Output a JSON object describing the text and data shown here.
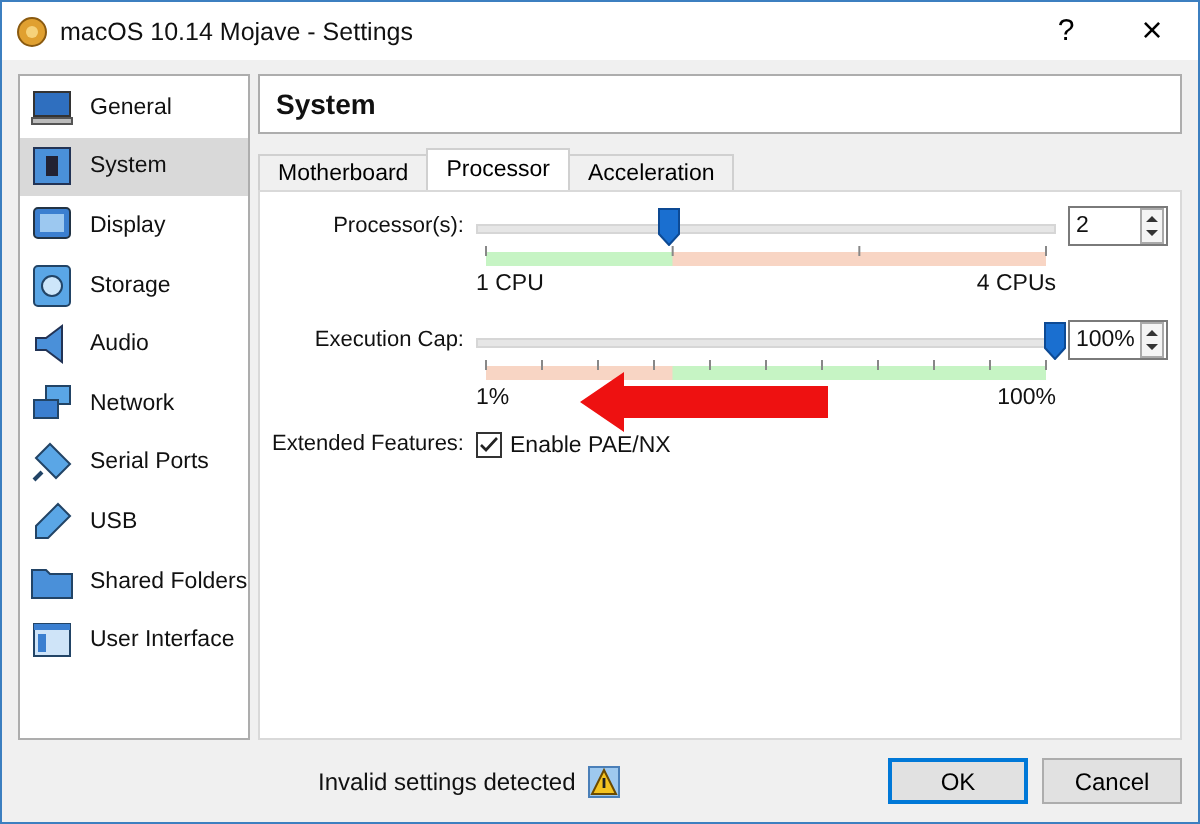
{
  "window": {
    "title": "macOS 10.14 Mojave - Settings",
    "help_button": "?",
    "close_button": "×"
  },
  "sidebar": {
    "items": [
      {
        "label": "General",
        "selected": false
      },
      {
        "label": "System",
        "selected": true
      },
      {
        "label": "Display",
        "selected": false
      },
      {
        "label": "Storage",
        "selected": false
      },
      {
        "label": "Audio",
        "selected": false
      },
      {
        "label": "Network",
        "selected": false
      },
      {
        "label": "Serial Ports",
        "selected": false
      },
      {
        "label": "USB",
        "selected": false
      },
      {
        "label": "Shared Folders",
        "selected": false
      },
      {
        "label": "User Interface",
        "selected": false
      }
    ]
  },
  "section_title": "System",
  "tabs": [
    {
      "label": "Motherboard",
      "selected": false
    },
    {
      "label": "Processor",
      "selected": true
    },
    {
      "label": "Acceleration",
      "selected": false
    }
  ],
  "sliders": [
    {
      "label": "Processor(s):",
      "level": 0.333,
      "min_label": "1 CPU",
      "max_label": "4 CPUs",
      "value": "2"
    },
    {
      "label": "Execution Cap:",
      "level": 1,
      "min_label": "1%",
      "max_label": "100%",
      "value": "100%"
    }
  ],
  "extended_features": {
    "label": "Extended Features:",
    "checkbox": {
      "label": "Enable PAE/NX",
      "checked": true
    }
  },
  "status": {
    "text": "Invalid settings detected"
  },
  "buttons": [
    {
      "label": "OK",
      "default": true
    },
    {
      "label": "Cancel",
      "default": false
    }
  ]
}
